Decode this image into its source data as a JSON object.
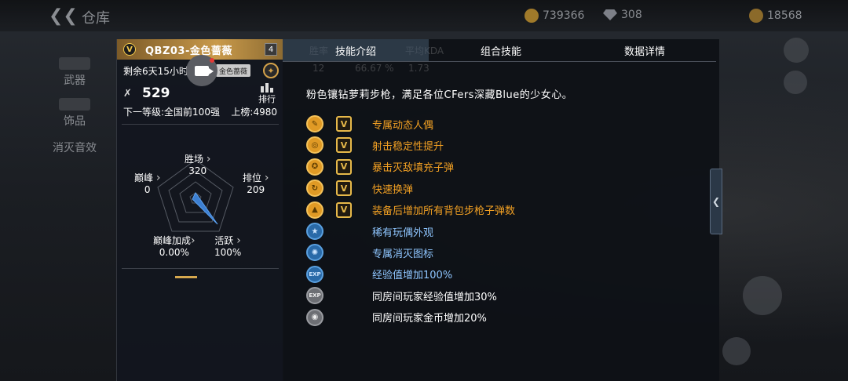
{
  "top": {
    "back_icon": "back-chevron-icon",
    "title": "仓库",
    "currency1_value": "739366",
    "currency2_value": "308",
    "currency3_value": "18568"
  },
  "nav": {
    "items": [
      {
        "label": "武器"
      },
      {
        "label": "饰品"
      },
      {
        "label": "消灭音效"
      }
    ]
  },
  "card": {
    "weapon_name": "QBZ03-金色蔷薇",
    "badge_letter": "V",
    "level": "4",
    "time_left": "剩余6天15小时",
    "skin_tag": "金色蔷薇",
    "kills": "529",
    "rank_label": "排行",
    "next_level": "下一等级:全国前100强",
    "on_board": "上榜:4980",
    "stats": {
      "wins_label": "胜场",
      "wins_value": "320",
      "rank_label": "排位",
      "rank_value": "209",
      "active_label": "活跃",
      "active_value": "100%",
      "peak_bonus_label": "巅峰加成",
      "peak_bonus_value": "0.00%",
      "peak_label": "巅峰",
      "peak_value": "0"
    }
  },
  "panel": {
    "tabs": [
      {
        "label": "技能介绍"
      },
      {
        "label": "组合技能"
      },
      {
        "label": "数据详情"
      }
    ],
    "description": "粉色镶钻萝莉步枪，满足各位CFers深藏Blue的少女心。",
    "skills": [
      {
        "label": "专属动态人偶",
        "tier": "gold",
        "icon": "doll-icon",
        "symbol": "✎",
        "has_v": true
      },
      {
        "label": "射击稳定性提升",
        "tier": "gold",
        "icon": "stability-icon",
        "symbol": "◎",
        "has_v": true
      },
      {
        "label": "暴击灭敌填充子弹",
        "tier": "gold",
        "icon": "bullet-refill-icon",
        "symbol": "✪",
        "has_v": true
      },
      {
        "label": "快速换弹",
        "tier": "gold",
        "icon": "fast-reload-icon",
        "symbol": "↻",
        "has_v": true
      },
      {
        "label": "装备后增加所有背包步枪子弹数",
        "tier": "gold",
        "icon": "ammo-icon",
        "symbol": "▲",
        "has_v": true
      },
      {
        "label": "稀有玩偶外观",
        "tier": "blue",
        "icon": "star-icon",
        "symbol": "★",
        "has_v": false
      },
      {
        "label": "专属消灭图标",
        "tier": "blue",
        "icon": "kill-icon",
        "symbol": "✺",
        "has_v": false
      },
      {
        "label": "经验值增加100%",
        "tier": "blue",
        "icon": "exp-icon",
        "symbol": "EXP",
        "has_v": false
      },
      {
        "label": "同房间玩家经验值增加30%",
        "tier": "grey",
        "icon": "room-exp-icon",
        "symbol": "EXP",
        "has_v": false
      },
      {
        "label": "同房间玩家金币增加20%",
        "tier": "grey",
        "icon": "room-coin-icon",
        "symbol": "◉",
        "has_v": false
      }
    ],
    "ghost_text": [
      "胜率",
      "平均KDA",
      "12",
      "66.67 %",
      "1.73"
    ]
  },
  "colors": {
    "gold_text": "#f2a023",
    "blue_text": "#8fc6ff",
    "white_text": "#ffffff",
    "accent": "#d6a84e"
  }
}
